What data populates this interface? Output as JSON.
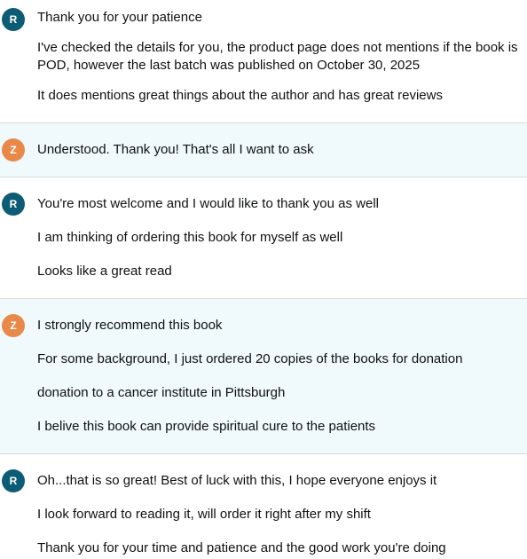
{
  "avatars": {
    "agent_initial": "R",
    "user_initial": "Z"
  },
  "colors": {
    "agent_avatar": "#0d5c75",
    "user_avatar": "#e8894a",
    "user_bubble_bg": "#f0f9fc"
  },
  "messages": [
    {
      "sender": "agent",
      "lines": [
        "Thank you for your patience",
        "I've checked the details for you, the product page does not mentions if the book is POD, however the last batch was published on October 30, 2025",
        "It does mentions great things about the author and has great reviews"
      ]
    },
    {
      "sender": "user",
      "lines": [
        "Understood. Thank you! That's all I want to ask"
      ]
    },
    {
      "sender": "agent",
      "lines": [
        "You're most welcome and I would like to thank you as well",
        "I am thinking of ordering this book for myself as well",
        "Looks like a great read"
      ]
    },
    {
      "sender": "user",
      "lines": [
        "I strongly recommend this book",
        "For some background, I just ordered 20 copies of the books for donation",
        "donation to a cancer institute in Pittsburgh",
        "I belive this book can provide spiritual cure to the patients"
      ]
    },
    {
      "sender": "agent",
      "lines": [
        "Oh...that is so great! Best of luck with this, I hope everyone enjoys it",
        "I look forward to reading it, will order it right after my shift",
        "Thank you for your time and patience and the good work you're doing"
      ]
    }
  ]
}
